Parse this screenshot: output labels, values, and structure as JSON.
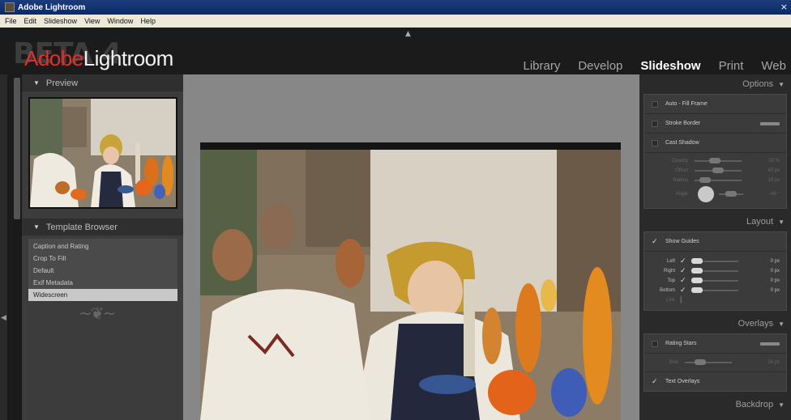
{
  "window": {
    "title": "Adobe Lightroom",
    "close_glyph": "×"
  },
  "menu": [
    "File",
    "Edit",
    "Slideshow",
    "View",
    "Window",
    "Help"
  ],
  "identity": {
    "beta": "BETA 4",
    "adobe": "Adobe",
    "lightroom": "Lightroom"
  },
  "modules": [
    {
      "label": "Library",
      "active": false
    },
    {
      "label": "Develop",
      "active": false
    },
    {
      "label": "Slideshow",
      "active": true
    },
    {
      "label": "Print",
      "active": false
    },
    {
      "label": "Web",
      "active": false
    }
  ],
  "left_panel": {
    "preview_title": "Preview",
    "template_title": "Template Browser",
    "templates": [
      "Caption and Rating",
      "Crop To Fill",
      "Default",
      "Exif Metadata",
      "Widescreen"
    ],
    "selected_template": "Widescreen"
  },
  "right_panel": {
    "options": {
      "title": "Options",
      "auto_fill": "Auto - Fill Frame",
      "stroke_border": "Stroke Border",
      "cast_shadow": "Cast Shadow",
      "shadow_sliders": [
        {
          "label": "Opacity",
          "value": "33 %"
        },
        {
          "label": "Offset",
          "value": "40 px"
        },
        {
          "label": "Radius",
          "value": "19 px"
        },
        {
          "label": "Angle",
          "value": "-46 °"
        }
      ]
    },
    "layout": {
      "title": "Layout",
      "show_guides": "Show Guides",
      "guides": [
        {
          "label": "Left",
          "value": "0 px"
        },
        {
          "label": "Right",
          "value": "0 px"
        },
        {
          "label": "Top",
          "value": "0 px"
        },
        {
          "label": "Bottom",
          "value": "0 px"
        }
      ],
      "link": "Link"
    },
    "overlays": {
      "title": "Overlays",
      "rating_stars": "Rating Stars",
      "size_label": "Size",
      "size_value": "24 px",
      "text_overlays": "Text Overlays"
    },
    "backdrop": {
      "title": "Backdrop"
    }
  },
  "icons": {
    "collapse": "triangle-down",
    "top_panel_toggle": "triangle-up",
    "left_panel_toggle": "triangle-left",
    "check": "checkmark"
  },
  "colors": {
    "adobe_red": "#e0302a",
    "panel_bg": "#3c3c3c",
    "center_bg": "#878787"
  }
}
